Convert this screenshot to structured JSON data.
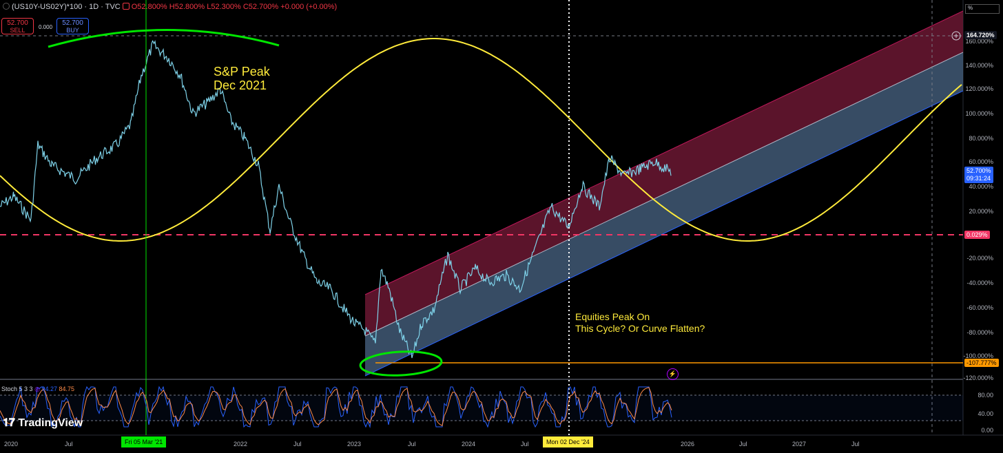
{
  "header": {
    "symbol": "(US10Y-US02Y)*100 · 1D · TVC",
    "open": "O52.800%",
    "high": "H52.800%",
    "low": "L52.300%",
    "close": "C52.700%",
    "change": "+0.000 (+0.00%)"
  },
  "trade": {
    "sell_price": "52.700",
    "sell_label": "SELL",
    "spread": "0.000",
    "buy_price": "52.700",
    "buy_label": "BUY"
  },
  "scale_label": "%",
  "annotations": {
    "sp_peak_line1": "S&P Peak",
    "sp_peak_line2": "Dec 2021",
    "equities_line1": "Equities Peak On",
    "equities_line2": "This Cycle? Or Curve Flatten?"
  },
  "y_axis": {
    "ticks": [
      "160.000%",
      "140.000%",
      "120.000%",
      "100.000%",
      "80.000%",
      "60.000%",
      "40.000%",
      "20.000%",
      "-20.000%",
      "-40.000%",
      "-60.000%",
      "-80.000%",
      "-100.000%",
      "-120.000%"
    ],
    "crosshair_value": "164.720%",
    "last_price": "52.700%",
    "countdown": "09:31:24",
    "hline_value": "0.029%",
    "low_value": "-107.777%"
  },
  "stoch": {
    "name": "Stoch 5 3 3",
    "k": "94.27",
    "d": "84.75",
    "ticks": [
      "80.00",
      "40.00",
      "0.00"
    ]
  },
  "x_axis": {
    "labels": [
      "2020",
      "Jul",
      "2022",
      "Jul",
      "2023",
      "Jul",
      "2024",
      "Jul",
      "2026",
      "Jul",
      "2027",
      "Jul"
    ],
    "crosshair_date_1": "Fri 05 Mar '21",
    "crosshair_date_2": "Mon 02 Dec '24"
  },
  "logo": "TradingView",
  "colors": {
    "price_line": "#7fd3ea",
    "sine": "#ffeb3b",
    "hline": "#f23665",
    "low_line": "#ff9800",
    "green_mark": "#00e600",
    "channel_upper": "#8b1a3c",
    "channel_lower": "#3a5577",
    "stoch_k": "#2962ff",
    "stoch_d": "#ff8c4a"
  }
}
